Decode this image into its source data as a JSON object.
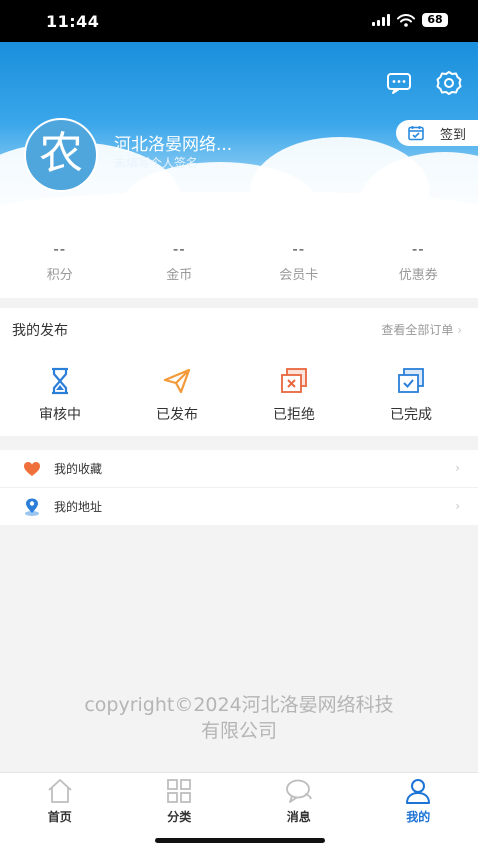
{
  "status": {
    "time": "11:44",
    "battery": "68"
  },
  "profile": {
    "avatar_char": "农",
    "name": "河北洛晏网络...",
    "signature": "未填写个人签名",
    "checkin_label": "签到"
  },
  "stats": [
    {
      "value": "--",
      "label": "积分"
    },
    {
      "value": "--",
      "label": "金币"
    },
    {
      "value": "--",
      "label": "会员卡"
    },
    {
      "value": "--",
      "label": "优惠券"
    }
  ],
  "publish": {
    "title": "我的发布",
    "view_all": "查看全部订单",
    "items": [
      {
        "label": "审核中",
        "icon": "hourglass-icon"
      },
      {
        "label": "已发布",
        "icon": "paper-plane-icon"
      },
      {
        "label": "已拒绝",
        "icon": "rejected-icon"
      },
      {
        "label": "已完成",
        "icon": "completed-icon"
      }
    ]
  },
  "menu": [
    {
      "label": "我的收藏",
      "icon": "heart-icon"
    },
    {
      "label": "我的地址",
      "icon": "location-icon"
    }
  ],
  "copyright": {
    "line1": "copyright©2024河北洛晏网络科技",
    "line2": "有限公司"
  },
  "tabs": [
    {
      "label": "首页",
      "icon": "home-icon"
    },
    {
      "label": "分类",
      "icon": "grid-icon"
    },
    {
      "label": "消息",
      "icon": "chat-icon"
    },
    {
      "label": "我的",
      "icon": "user-icon",
      "active": true
    }
  ],
  "colors": {
    "accent": "#1b73d6",
    "orange": "#f29a38",
    "heart": "#f0703c",
    "header_blue": "#1a8fdc"
  }
}
